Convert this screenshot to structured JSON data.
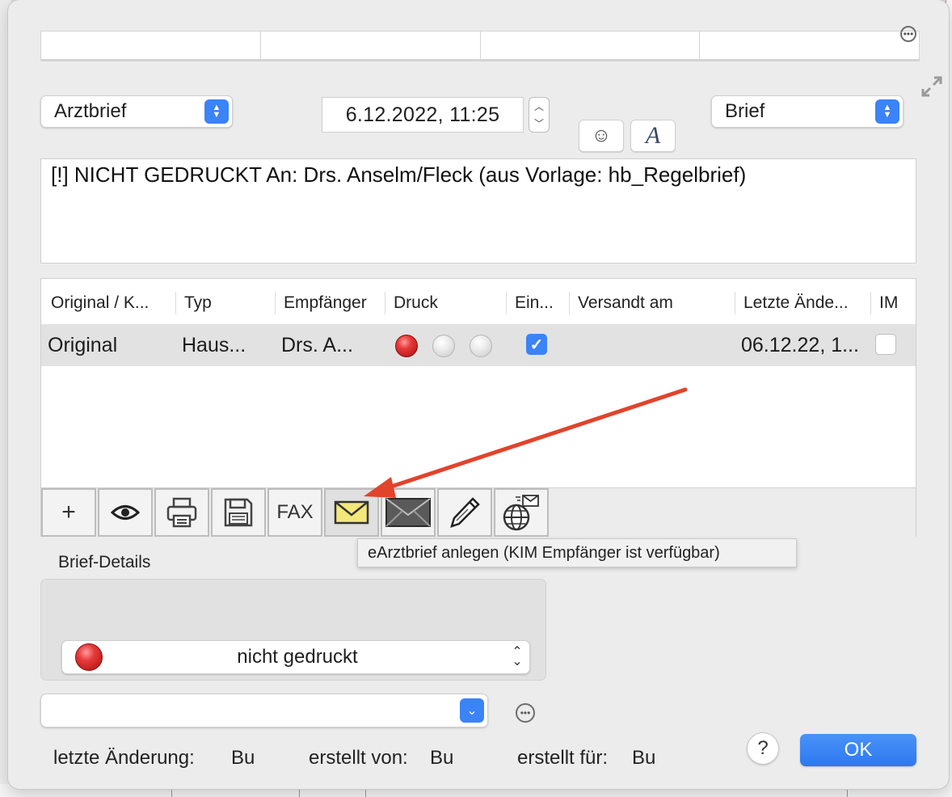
{
  "header": {
    "category_popup": "Arztbrief",
    "date_field": "6.12.2022, 11:25",
    "type_popup": "Brief",
    "emoji_button": "☺",
    "font_button": "A"
  },
  "subject": "[!] NICHT GEDRUCKT An:  Drs. Anselm/Fleck (aus Vorlage: hb_Regelbrief)",
  "table": {
    "columns": [
      "Original / K...",
      "Typ",
      "Empfänger",
      "Druck",
      "Ein...",
      "Versandt am",
      "Letzte Ände...",
      "IM"
    ],
    "rows": [
      {
        "original": "Original",
        "typ": "Haus...",
        "empfaenger": "Drs. A...",
        "druck": [
          "red",
          "grey",
          "grey"
        ],
        "ein": true,
        "versandt_am": "",
        "letzte_aenderung": "06.12.22, 1...",
        "im": false
      }
    ]
  },
  "toolbar": {
    "add": "+",
    "fax_label": "FAX",
    "buttons": [
      "add-icon",
      "eye-icon",
      "printer-icon",
      "floppy-disk-icon",
      "fax-button",
      "envelope-yellow-icon",
      "envelope-dark-icon",
      "pencil-icon",
      "globe-mail-icon"
    ]
  },
  "tooltip": "eArztbrief anlegen (KIM Empfänger ist verfügbar)",
  "details": {
    "label": "Brief-Details",
    "status": "nicht gedruckt"
  },
  "footer": {
    "letzte_label": "letzte Änderung:",
    "letzte_value": "Bu",
    "erstellt_von_label": "erstellt von:",
    "erstellt_von_value": "Bu",
    "erstellt_fuer_label": "erstellt für:",
    "erstellt_fuer_value": "Bu",
    "help": "?",
    "ok": "OK"
  },
  "colors": {
    "accent": "#3b83f6",
    "annotation_arrow": "#e2432b"
  }
}
